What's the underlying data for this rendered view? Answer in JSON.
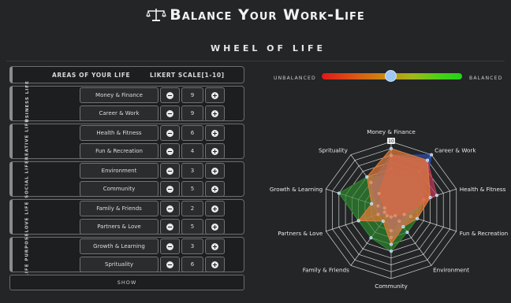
{
  "header": {
    "title": "Balance Your Work-Life",
    "subtitle": "WHEEL OF LIFE"
  },
  "table": {
    "col_area": "AREAS OF YOUR LIFE",
    "col_scale": "LIKERT SCALE[1-10]",
    "groups": [
      {
        "label": "BUSINESS LIFE",
        "items": [
          {
            "name": "Money & Finance",
            "value": 9
          },
          {
            "name": "Career & Work",
            "value": 9
          }
        ]
      },
      {
        "label": "CREATIVE LIFE",
        "items": [
          {
            "name": "Health & Fitness",
            "value": 6
          },
          {
            "name": "Fun & Recreation",
            "value": 4
          }
        ]
      },
      {
        "label": "SOCIAL LIFE",
        "items": [
          {
            "name": "Environment",
            "value": 3
          },
          {
            "name": "Community",
            "value": 5
          }
        ]
      },
      {
        "label": "LOVE LIFE",
        "items": [
          {
            "name": "Family & Friends",
            "value": 2
          },
          {
            "name": "Partners & Love",
            "value": 5
          }
        ]
      },
      {
        "label": "LIFE PURPOSE",
        "items": [
          {
            "name": "Growth & Learning",
            "value": 3
          },
          {
            "name": "Sprituality",
            "value": 6
          }
        ]
      }
    ],
    "show_label": "SHOW"
  },
  "balance": {
    "left_label": "UNBALANCED",
    "right_label": "BALANCED",
    "level": 0.49
  },
  "chart_data": {
    "type": "radar",
    "axes": [
      "Money & Finance",
      "Career & Work",
      "Health & Fitness",
      "Fun & Recreation",
      "Environment",
      "Community",
      "Family & Friends",
      "Partners & Love",
      "Growth & Learning",
      "Sprituality"
    ],
    "max_tick": "10",
    "rmax": 10,
    "series": [
      {
        "values": [
          9,
          9,
          6,
          4,
          3,
          5,
          2,
          5,
          3,
          6
        ],
        "color": "#e07a3a"
      },
      {
        "values": [
          8,
          9,
          7,
          2,
          1,
          1,
          1,
          1,
          1,
          3
        ],
        "color": "#c23b5c"
      },
      {
        "values": [
          8,
          10,
          5,
          2,
          2,
          3,
          1,
          2,
          2,
          5
        ],
        "color": "#2b4fb0"
      },
      {
        "values": [
          5,
          6,
          5,
          4,
          4,
          6,
          5,
          5,
          8,
          6
        ],
        "color": "#2e8a2e"
      },
      {
        "values": [
          6,
          7,
          5,
          3,
          3,
          4,
          1,
          2,
          3,
          5
        ],
        "color": "#2a78a8"
      }
    ]
  },
  "colors": {
    "background": "#232526",
    "panel": "#1c1e1f",
    "border": "#707274",
    "knob": "#9ec8f5"
  }
}
